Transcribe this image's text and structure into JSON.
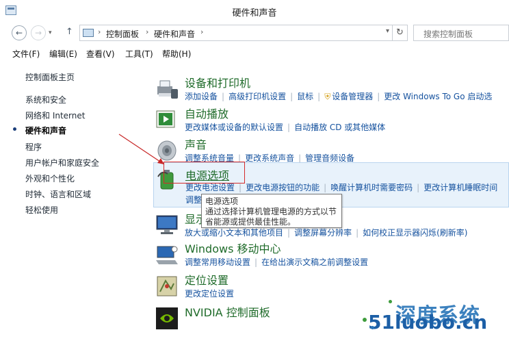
{
  "window": {
    "title": "硬件和声音"
  },
  "address": {
    "crumbs": [
      "控制面板",
      "硬件和声音"
    ],
    "search_placeholder": "搜索控制面板"
  },
  "menu": [
    "文件(F)",
    "编辑(E)",
    "查看(V)",
    "工具(T)",
    "帮助(H)"
  ],
  "sidebar": {
    "items": [
      {
        "label": "控制面板主页"
      },
      {
        "label": "系统和安全"
      },
      {
        "label": "网络和 Internet"
      },
      {
        "label": "硬件和声音"
      },
      {
        "label": "程序"
      },
      {
        "label": "用户帐户和家庭安全"
      },
      {
        "label": "外观和个性化"
      },
      {
        "label": "时钟、语言和区域"
      },
      {
        "label": "轻松使用"
      }
    ]
  },
  "categories": [
    {
      "title": "设备和打印机",
      "links": [
        "添加设备",
        "高级打印机设置",
        "鼠标",
        "设备管理器",
        "更改 Windows To Go 启动选"
      ],
      "icon": "printer-icon"
    },
    {
      "title": "自动播放",
      "links": [
        "更改媒体或设备的默认设置",
        "自动播放 CD 或其他媒体"
      ],
      "icon": "autoplay-icon"
    },
    {
      "title": "声音",
      "links": [
        "调整系统音量",
        "更改系统声音",
        "管理音频设备"
      ],
      "icon": "speaker-icon"
    },
    {
      "title": "电源选项",
      "links": [
        "更改电池设置",
        "更改电源按钮的功能",
        "唤醒计算机时需要密码",
        "更改计算机睡眠时间"
      ],
      "link2": "调整",
      "icon": "battery-icon"
    },
    {
      "title": "显示",
      "links": [
        "放大或缩小文本和其他项目",
        "调整屏幕分辨率",
        "如何校正显示器闪烁(刷新率)"
      ],
      "icon": "monitor-icon"
    },
    {
      "title": "Windows 移动中心",
      "links": [
        "调整常用移动设置",
        "在给出演示文稿之前调整设置"
      ],
      "icon": "mobility-icon"
    },
    {
      "title": "定位设置",
      "links": [
        "更改定位设置"
      ],
      "icon": "location-icon"
    },
    {
      "title": "NVIDIA 控制面板",
      "links": [],
      "icon": "nvidia-icon"
    }
  ],
  "tooltip": {
    "title": "电源选项",
    "body": "通过选择计算机管理电源的方式以节省能源或提供最佳性能。"
  },
  "watermark": {
    "brand": "深度系统",
    "url": "51luobo.cn"
  },
  "colors": {
    "link": "#14519e",
    "category_title": "#1f6b2a",
    "highlight": "#d42a2a"
  }
}
